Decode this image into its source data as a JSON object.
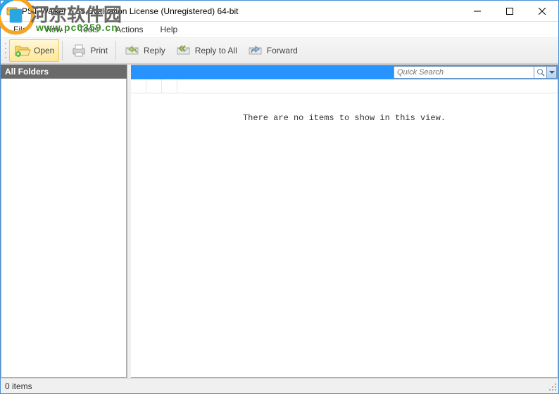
{
  "titlebar": {
    "title": "PST Walker 5.55 Evaluation License (Unregistered) 64-bit"
  },
  "menubar": {
    "file": "File",
    "view": "View",
    "tools": "Tools",
    "actions": "Actions",
    "help": "Help"
  },
  "toolbar": {
    "open": "Open",
    "print": "Print",
    "reply": "Reply",
    "reply_all": "Reply to All",
    "forward": "Forward"
  },
  "sidebar": {
    "title": "All Folders"
  },
  "search": {
    "placeholder": "Quick Search"
  },
  "content": {
    "empty": "There are no items to show in this view."
  },
  "status": {
    "text": "0 items"
  },
  "watermark": {
    "text": "河东软件园",
    "url": "www.pc0359.cn"
  }
}
